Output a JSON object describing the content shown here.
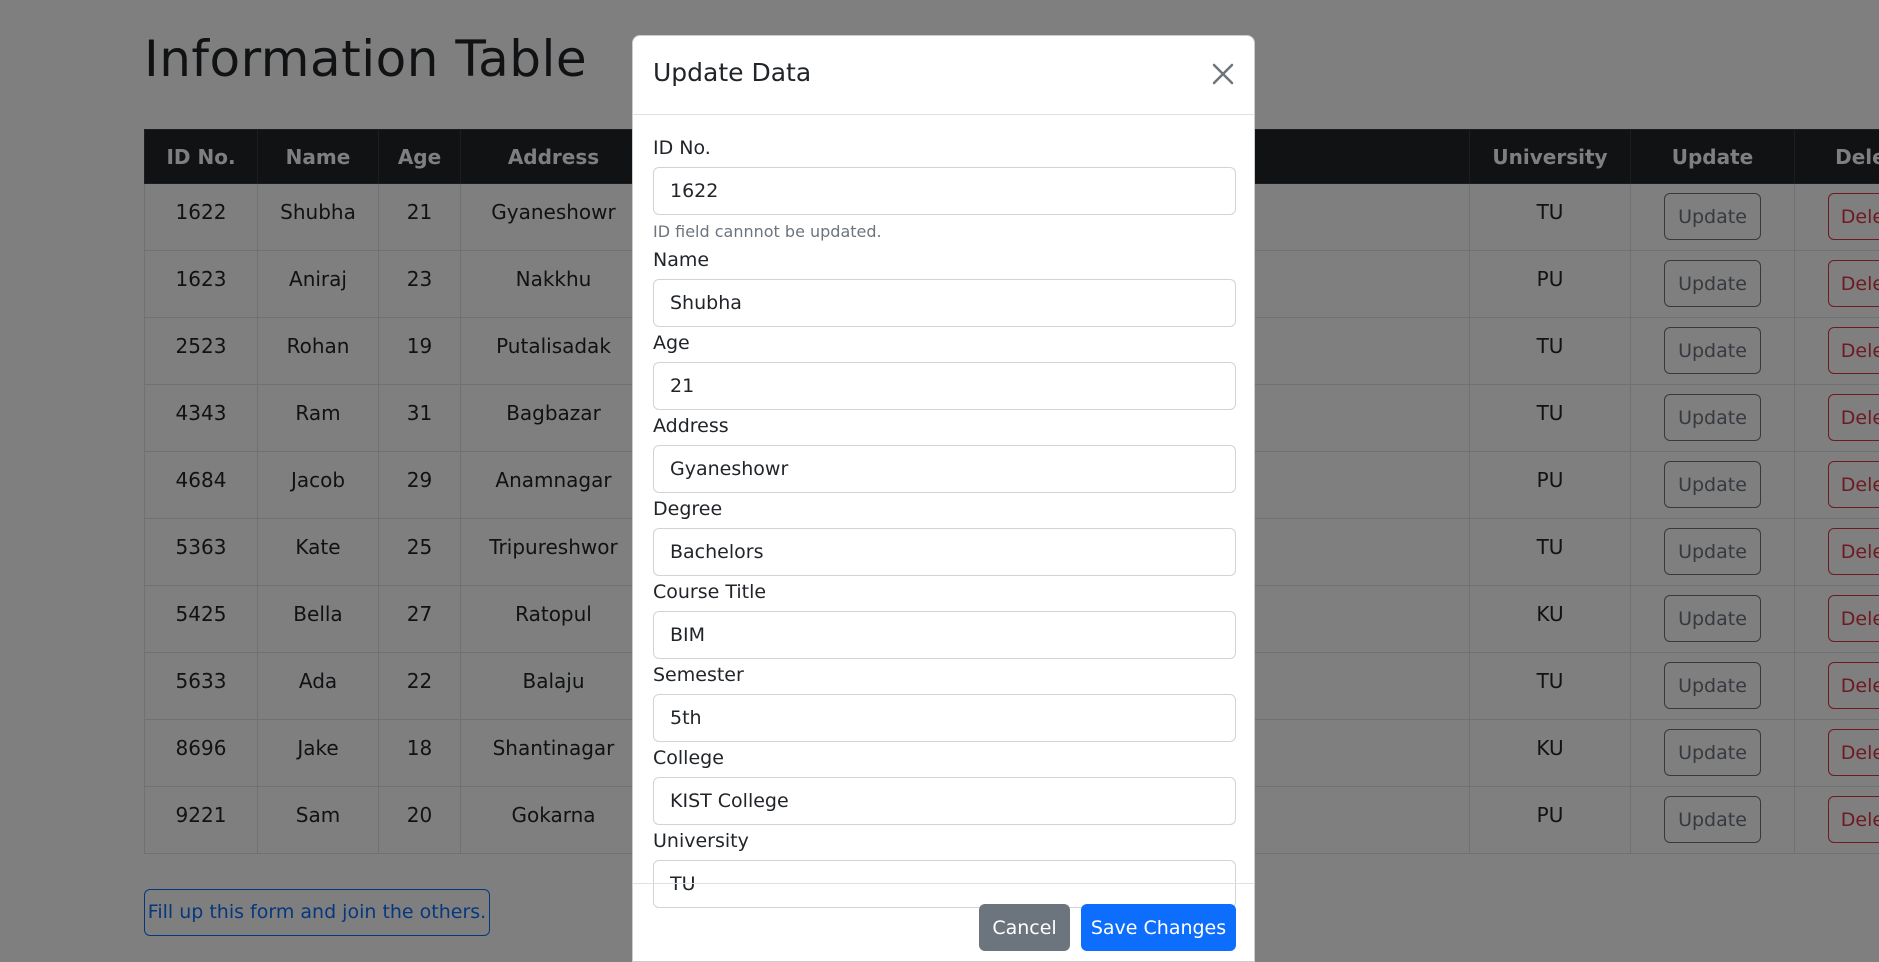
{
  "page": {
    "title": "Information Table",
    "join_link": "Fill up this form and join the others."
  },
  "table": {
    "visible_headers": {
      "id": "ID No.",
      "name": "Name",
      "age": "Age",
      "address": "Address",
      "university": "University",
      "update": "Update",
      "delete": "Delete"
    },
    "rows": [
      {
        "id": "1622",
        "name": "Shubha",
        "age": "21",
        "address": "Gyaneshowr",
        "university": "TU"
      },
      {
        "id": "1623",
        "name": "Aniraj",
        "age": "23",
        "address": "Nakkhu",
        "university": "PU"
      },
      {
        "id": "2523",
        "name": "Rohan",
        "age": "19",
        "address": "Putalisadak",
        "university": "TU"
      },
      {
        "id": "4343",
        "name": "Ram",
        "age": "31",
        "address": "Bagbazar",
        "university": "TU"
      },
      {
        "id": "4684",
        "name": "Jacob",
        "age": "29",
        "address": "Anamnagar",
        "university": "PU"
      },
      {
        "id": "5363",
        "name": "Kate",
        "age": "25",
        "address": "Tripureshwor",
        "university": "TU"
      },
      {
        "id": "5425",
        "name": "Bella",
        "age": "27",
        "address": "Ratopul",
        "university": "KU"
      },
      {
        "id": "5633",
        "name": "Ada",
        "age": "22",
        "address": "Balaju",
        "university": "TU"
      },
      {
        "id": "8696",
        "name": "Jake",
        "age": "18",
        "address": "Shantinagar",
        "university": "KU"
      },
      {
        "id": "9221",
        "name": "Sam",
        "age": "20",
        "address": "Gokarna",
        "university": "PU"
      }
    ],
    "update_label": "Update",
    "delete_label": "Delete"
  },
  "modal": {
    "title": "Update Data",
    "close_icon": "close-icon",
    "id_help": "ID field cannnot be updated.",
    "fields": [
      {
        "key": "id",
        "label": "ID No.",
        "value": "1622"
      },
      {
        "key": "name",
        "label": "Name",
        "value": "Shubha"
      },
      {
        "key": "age",
        "label": "Age",
        "value": "21"
      },
      {
        "key": "address",
        "label": "Address",
        "value": "Gyaneshowr"
      },
      {
        "key": "degree",
        "label": "Degree",
        "value": "Bachelors"
      },
      {
        "key": "course",
        "label": "Course Title",
        "value": "BIM"
      },
      {
        "key": "semester",
        "label": "Semester",
        "value": "5th"
      },
      {
        "key": "college",
        "label": "College",
        "value": "KIST College"
      },
      {
        "key": "university",
        "label": "University",
        "value": "TU"
      }
    ],
    "cancel_label": "Cancel",
    "save_label": "Save Changes"
  },
  "colors": {
    "primary": "#0d6efd",
    "secondary": "#6c757d",
    "danger": "#dc3545",
    "dark": "#212529",
    "backdrop": "rgba(0,0,0,0.5)"
  }
}
